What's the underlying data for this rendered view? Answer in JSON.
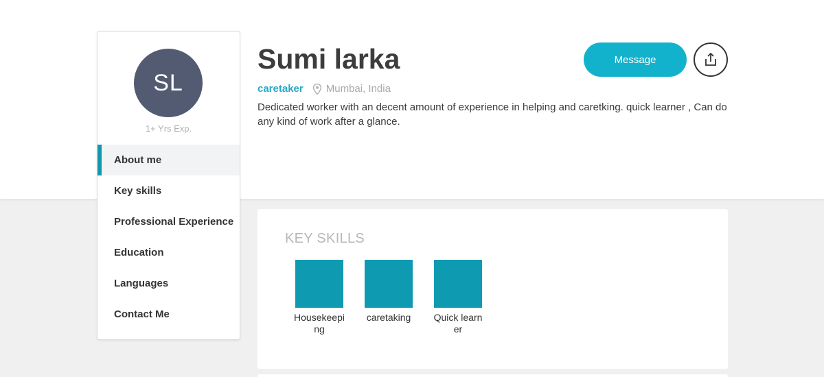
{
  "profile": {
    "initials": "SL",
    "experience": "1+ Yrs Exp.",
    "name": "Sumi larka",
    "role": "caretaker",
    "location": "Mumbai, India",
    "bio": "Dedicated worker with an decent amount of experience in helping and caretking. quick learner , Can do any kind of work after a glance."
  },
  "actions": {
    "message_label": "Message",
    "share_icon": "share-icon"
  },
  "sidebar": {
    "items": [
      {
        "label": "About me",
        "active": true
      },
      {
        "label": "Key skills"
      },
      {
        "label": "Professional Experience"
      },
      {
        "label": "Education"
      },
      {
        "label": "Languages"
      },
      {
        "label": "Contact Me"
      }
    ]
  },
  "skills": {
    "title": "KEY SKILLS",
    "items": [
      {
        "label": "Housekeeping"
      },
      {
        "label": "caretaking"
      },
      {
        "label": "Quick learner"
      }
    ]
  },
  "colors": {
    "accent": "#12b2cc",
    "skill_tile": "#0e9ab1",
    "avatar_bg": "#535b72"
  }
}
